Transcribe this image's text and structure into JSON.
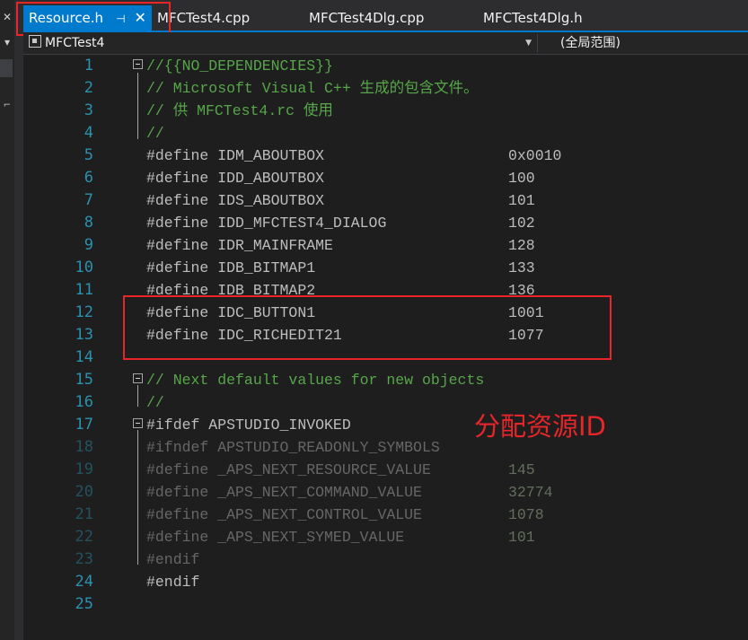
{
  "tabs": [
    {
      "label": "Resource.h",
      "active": true
    },
    {
      "label": "MFCTest4.cpp",
      "active": false
    },
    {
      "label": "MFCTest4Dlg.cpp",
      "active": false
    },
    {
      "label": "MFCTest4Dlg.h",
      "active": false
    }
  ],
  "navbar": {
    "project": "MFCTest4",
    "scope": "(全局范围)"
  },
  "code_lines": [
    {
      "n": "1",
      "text": "//{{NO_DEPENDENCIES}}"
    },
    {
      "n": "2",
      "text": "// Microsoft Visual C++ 生成的包含文件。"
    },
    {
      "n": "3",
      "text": "// 供 MFCTest4.rc 使用"
    },
    {
      "n": "4",
      "text": "//"
    },
    {
      "n": "5",
      "text": "#define IDM_ABOUTBOX",
      "value": "0x0010"
    },
    {
      "n": "6",
      "text": "#define IDD_ABOUTBOX",
      "value": "100"
    },
    {
      "n": "7",
      "text": "#define IDS_ABOUTBOX",
      "value": "101"
    },
    {
      "n": "8",
      "text": "#define IDD_MFCTEST4_DIALOG",
      "value": "102"
    },
    {
      "n": "9",
      "text": "#define IDR_MAINFRAME",
      "value": "128"
    },
    {
      "n": "10",
      "text": "#define IDB_BITMAP1",
      "value": "133"
    },
    {
      "n": "11",
      "text": "#define IDB_BITMAP2",
      "value": "136"
    },
    {
      "n": "12",
      "text": "#define IDC_BUTTON1",
      "value": "1001"
    },
    {
      "n": "13",
      "text": "#define IDC_RICHEDIT21",
      "value": "1077"
    },
    {
      "n": "14",
      "text": ""
    },
    {
      "n": "15",
      "text": "// Next default values for new objects"
    },
    {
      "n": "16",
      "text": "//"
    },
    {
      "n": "17",
      "text": "#ifdef APSTUDIO_INVOKED"
    },
    {
      "n": "18",
      "text": "#ifndef APSTUDIO_READONLY_SYMBOLS"
    },
    {
      "n": "19",
      "text": "#define _APS_NEXT_RESOURCE_VALUE",
      "value": "145"
    },
    {
      "n": "20",
      "text": "#define _APS_NEXT_COMMAND_VALUE",
      "value": "32774"
    },
    {
      "n": "21",
      "text": "#define _APS_NEXT_CONTROL_VALUE",
      "value": "1078"
    },
    {
      "n": "22",
      "text": "#define _APS_NEXT_SYMED_VALUE",
      "value": "101"
    },
    {
      "n": "23",
      "text": "#endif"
    },
    {
      "n": "24",
      "text": "#endif"
    },
    {
      "n": "25",
      "text": ""
    }
  ],
  "annotation": {
    "label": "分配资源ID",
    "color": "#e8262a"
  },
  "colors": {
    "accent": "#007acc",
    "background": "#1e1e1e",
    "comment": "#57a64a",
    "line_number": "#2b91af"
  }
}
